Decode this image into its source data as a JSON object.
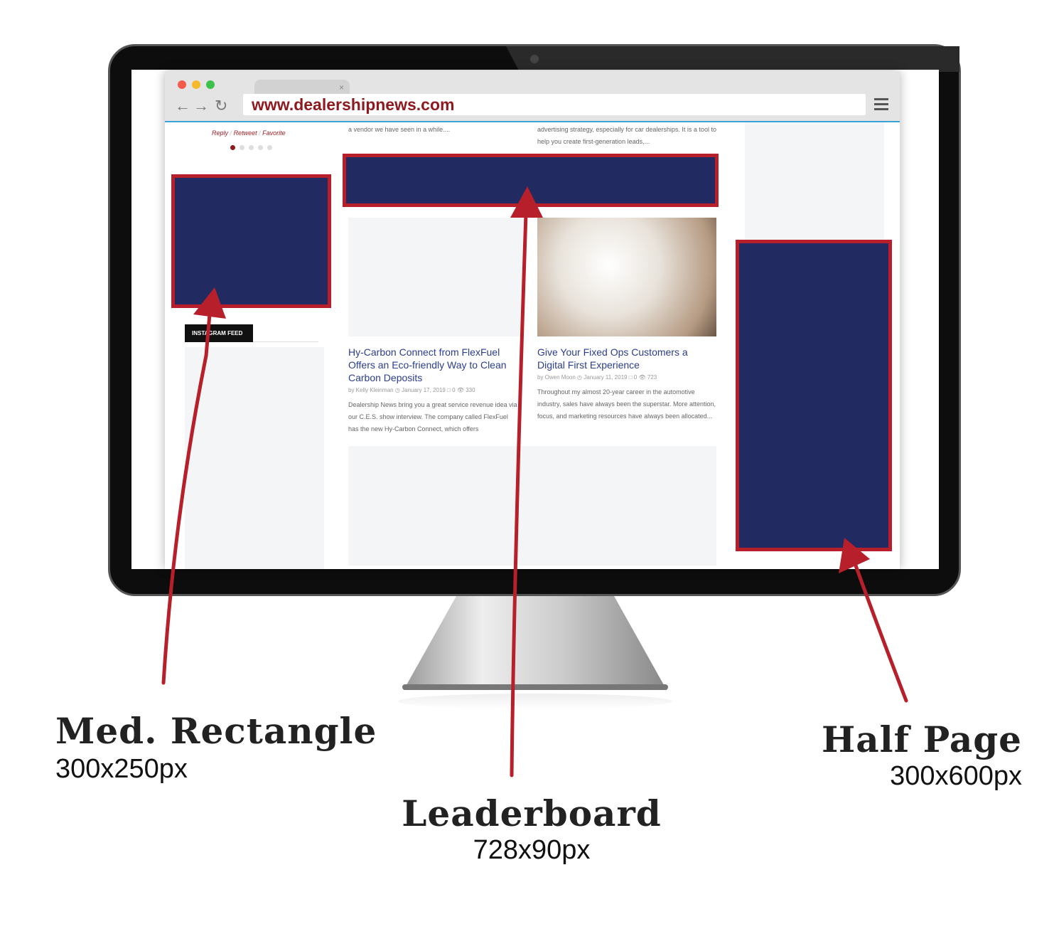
{
  "browser": {
    "url": "www.dealershipnews.com",
    "tab_close": "×",
    "back": "←",
    "forward": "→",
    "reload": "↻",
    "traffic_lights": [
      "#f45b4b",
      "#f6b92c",
      "#3cc24c"
    ]
  },
  "page": {
    "tweet_actions": [
      "Reply",
      "Retweet",
      "Favorite"
    ],
    "instagram_label": "INSTAGRAM FEED",
    "snippet_left": "a vendor we have seen in a while....",
    "snippet_right": "advertising strategy, especially for car dealerships. It is a tool to help you create first-generation leads,...",
    "articles": [
      {
        "title": "Hy-Carbon Connect from FlexFuel Offers an Eco-friendly Way to Clean Carbon Deposits",
        "author": "by Kelly Kleinman",
        "date": "January 17, 2019",
        "comments": "0",
        "views": "330",
        "excerpt": "Dealership News bring you a great service revenue idea via our C.E.S. show interview. The company called FlexFuel has the new Hy-Carbon Connect, which offers"
      },
      {
        "title": "Give Your Fixed Ops Customers a Digital First Experience",
        "author": "by Owen Moon",
        "date": "January 11, 2019",
        "comments": "0",
        "views": "723",
        "excerpt": "Throughout my almost 20-year career in the automotive industry, sales have always been the superstar. More attention, focus, and marketing resources have always been allocated..."
      }
    ]
  },
  "ads": [
    {
      "name": "Med. Rectangle",
      "size": "300x250px"
    },
    {
      "name": "Leaderboard",
      "size": "728x90px"
    },
    {
      "name": "Half Page",
      "size": "300x600px"
    }
  ],
  "colors": {
    "ad_fill": "#212a61",
    "ad_border": "#b7202a",
    "arrow": "#b7202a",
    "link": "#2b3d8f"
  }
}
